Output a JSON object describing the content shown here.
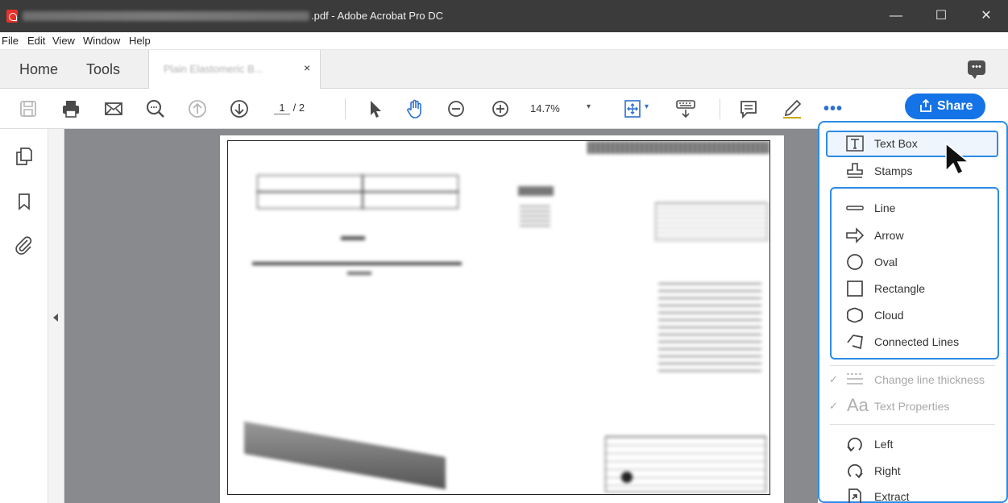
{
  "window": {
    "title_suffix": ".pdf - Adobe Acrobat Pro DC",
    "controls": {
      "minimize": "—",
      "maximize": "☐",
      "close": "✕"
    }
  },
  "menubar": {
    "items": [
      "File",
      "Edit",
      "View",
      "Window",
      "Help"
    ]
  },
  "tabs": {
    "home": "Home",
    "tools": "Tools",
    "document": "Plain Elastomeric B...",
    "close": "×"
  },
  "toolbar": {
    "page_current": "1",
    "page_total": "/ 2",
    "zoom": "14.7%",
    "zoom_caret": "▾",
    "more": "•••",
    "share_label": "Share"
  },
  "right_panel": {
    "top_items": [
      {
        "icon": "text-box-icon",
        "label": "Text Box"
      },
      {
        "icon": "stamp-icon",
        "label": "Stamps"
      }
    ],
    "shape_items": [
      {
        "icon": "line-icon",
        "label": "Line"
      },
      {
        "icon": "arrow-icon",
        "label": "Arrow"
      },
      {
        "icon": "oval-icon",
        "label": "Oval"
      },
      {
        "icon": "rectangle-icon",
        "label": "Rectangle"
      },
      {
        "icon": "cloud-icon",
        "label": "Cloud"
      },
      {
        "icon": "connected-lines-icon",
        "label": "Connected Lines"
      }
    ],
    "property_items": [
      {
        "icon": "line-thickness-icon",
        "label": "Change line thickness",
        "check": "✓",
        "disabled": true
      },
      {
        "icon": "text-properties-icon",
        "label": "Text Properties",
        "check": "✓",
        "glyph": "Aa",
        "disabled": true
      }
    ],
    "rotate_items": [
      {
        "icon": "rotate-left-icon",
        "label": "Left"
      },
      {
        "icon": "rotate-right-icon",
        "label": "Right"
      },
      {
        "icon": "extract-icon",
        "label": "Extract"
      }
    ]
  },
  "colors": {
    "accent": "#1473e6",
    "highlight_outline": "#2c8be6",
    "titlebar": "#3b3b3b",
    "document_background": "#888a8d"
  }
}
